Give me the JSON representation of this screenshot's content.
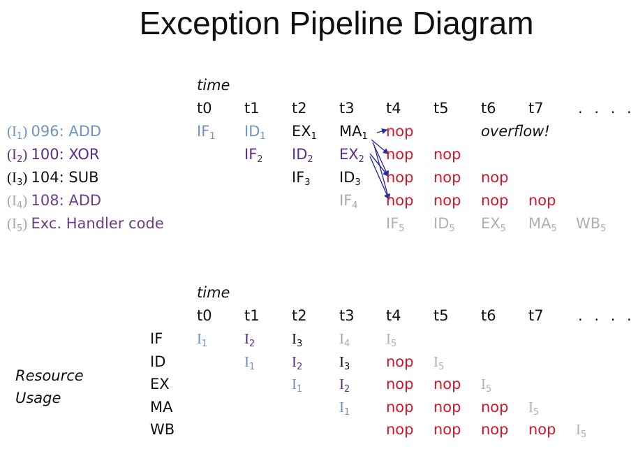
{
  "title": "Exception Pipeline Diagram",
  "colors": {
    "i1": "#6e93c4",
    "i2": "#5a2d82",
    "i3": "#111111",
    "i4": "#a8a8a8",
    "i5_label": "#6b3d8a",
    "i5_cell": "#b0b0b0",
    "nop": "#d5142b",
    "arrow": "#2c2e9e"
  },
  "pipeline": {
    "time_label": "time",
    "time_ticks": [
      "t0",
      "t1",
      "t2",
      "t3",
      "t4",
      "t5",
      "t6",
      "t7"
    ],
    "ellipsis": ". . . .",
    "instructions": [
      {
        "id": "I",
        "sub": "1",
        "addr_op": "096: ADD",
        "color": "i1",
        "cells": [
          {
            "col": 0,
            "base": "IF",
            "sub": "1",
            "color": "i1"
          },
          {
            "col": 1,
            "base": "ID",
            "sub": "1",
            "color": "i1"
          },
          {
            "col": 2,
            "base": "EX",
            "sub": "1",
            "color": "i3"
          },
          {
            "col": 3,
            "base": "MA",
            "sub": "1",
            "color": "i3"
          },
          {
            "col": 4,
            "base": "nop",
            "sub": "",
            "color": "nop"
          }
        ]
      },
      {
        "id": "I",
        "sub": "2",
        "addr_op": "100: XOR",
        "color": "i2",
        "cells": [
          {
            "col": 1,
            "base": "IF",
            "sub": "2",
            "color": "i2"
          },
          {
            "col": 2,
            "base": "ID",
            "sub": "2",
            "color": "i2"
          },
          {
            "col": 3,
            "base": "EX",
            "sub": "2",
            "color": "i2"
          },
          {
            "col": 4,
            "base": "nop",
            "sub": "",
            "color": "nop"
          },
          {
            "col": 5,
            "base": "nop",
            "sub": "",
            "color": "nop"
          }
        ]
      },
      {
        "id": "I",
        "sub": "3",
        "addr_op": "104: SUB",
        "color": "i3",
        "cells": [
          {
            "col": 2,
            "base": "IF",
            "sub": "3",
            "color": "i3"
          },
          {
            "col": 3,
            "base": "ID",
            "sub": "3",
            "color": "i3"
          },
          {
            "col": 4,
            "base": "nop",
            "sub": "",
            "color": "nop"
          },
          {
            "col": 5,
            "base": "nop",
            "sub": "",
            "color": "nop"
          },
          {
            "col": 6,
            "base": "nop",
            "sub": "",
            "color": "nop"
          }
        ]
      },
      {
        "id": "I",
        "sub": "4",
        "addr_op": "108: ADD",
        "color": "i4",
        "label_color": "i5_label",
        "cells": [
          {
            "col": 3,
            "base": "IF",
            "sub": "4",
            "color": "i4"
          },
          {
            "col": 4,
            "base": "nop",
            "sub": "",
            "color": "nop"
          },
          {
            "col": 5,
            "base": "nop",
            "sub": "",
            "color": "nop"
          },
          {
            "col": 6,
            "base": "nop",
            "sub": "",
            "color": "nop"
          },
          {
            "col": 7,
            "base": "nop",
            "sub": "",
            "color": "nop"
          }
        ]
      },
      {
        "id": "I",
        "sub": "5",
        "addr_op": "Exc. Handler code",
        "color": "i4",
        "label_color": "i5_label",
        "cells": [
          {
            "col": 4,
            "base": "IF",
            "sub": "5",
            "color": "i5_cell"
          },
          {
            "col": 5,
            "base": "ID",
            "sub": "5",
            "color": "i5_cell"
          },
          {
            "col": 6,
            "base": "EX",
            "sub": "5",
            "color": "i5_cell"
          },
          {
            "col": 7,
            "base": "MA",
            "sub": "5",
            "color": "i5_cell"
          },
          {
            "col": 8,
            "base": "WB",
            "sub": "5",
            "color": "i5_cell"
          }
        ]
      }
    ],
    "annotation": "overflow!"
  },
  "resource": {
    "time_label": "time",
    "time_ticks": [
      "t0",
      "t1",
      "t2",
      "t3",
      "t4",
      "t5",
      "t6",
      "t7"
    ],
    "ellipsis": ". . . .",
    "side_label_line1": "Resource",
    "side_label_line2": "Usage",
    "stages": [
      {
        "name": "IF",
        "cells": [
          {
            "col": 0,
            "base": "I",
            "sub": "1",
            "color": "i1"
          },
          {
            "col": 1,
            "base": "I",
            "sub": "2",
            "color": "i2"
          },
          {
            "col": 2,
            "base": "I",
            "sub": "3",
            "color": "i3"
          },
          {
            "col": 3,
            "base": "I",
            "sub": "4",
            "color": "i4"
          },
          {
            "col": 4,
            "base": "I",
            "sub": "5",
            "color": "i5_cell"
          }
        ]
      },
      {
        "name": "ID",
        "cells": [
          {
            "col": 1,
            "base": "I",
            "sub": "1",
            "color": "i1"
          },
          {
            "col": 2,
            "base": "I",
            "sub": "2",
            "color": "i2"
          },
          {
            "col": 3,
            "base": "I",
            "sub": "3",
            "color": "i3"
          },
          {
            "col": 4,
            "base": "nop",
            "sub": "",
            "color": "nop"
          },
          {
            "col": 5,
            "base": "I",
            "sub": "5",
            "color": "i5_cell"
          }
        ]
      },
      {
        "name": "EX",
        "cells": [
          {
            "col": 2,
            "base": "I",
            "sub": "1",
            "color": "i1"
          },
          {
            "col": 3,
            "base": "I",
            "sub": "2",
            "color": "i2"
          },
          {
            "col": 4,
            "base": "nop",
            "sub": "",
            "color": "nop"
          },
          {
            "col": 5,
            "base": "nop",
            "sub": "",
            "color": "nop"
          },
          {
            "col": 6,
            "base": "I",
            "sub": "5",
            "color": "i5_cell"
          }
        ]
      },
      {
        "name": "MA",
        "cells": [
          {
            "col": 3,
            "base": "I",
            "sub": "1",
            "color": "i1"
          },
          {
            "col": 4,
            "base": "nop",
            "sub": "",
            "color": "nop"
          },
          {
            "col": 5,
            "base": "nop",
            "sub": "",
            "color": "nop"
          },
          {
            "col": 6,
            "base": "nop",
            "sub": "",
            "color": "nop"
          },
          {
            "col": 7,
            "base": "I",
            "sub": "5",
            "color": "i5_cell"
          }
        ]
      },
      {
        "name": "WB",
        "cells": [
          {
            "col": 4,
            "base": "nop",
            "sub": "",
            "color": "nop"
          },
          {
            "col": 5,
            "base": "nop",
            "sub": "",
            "color": "nop"
          },
          {
            "col": 6,
            "base": "nop",
            "sub": "",
            "color": "nop"
          },
          {
            "col": 7,
            "base": "nop",
            "sub": "",
            "color": "nop"
          },
          {
            "col": 8,
            "base": "I",
            "sub": "5",
            "color": "i5_cell"
          }
        ]
      }
    ]
  }
}
